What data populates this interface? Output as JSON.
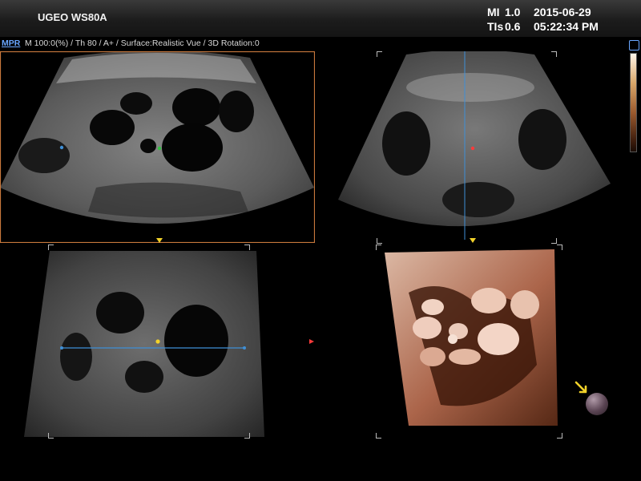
{
  "header": {
    "device_name": "UGEO WS80A",
    "mi_label": "MI",
    "mi_value": "1.0",
    "tis_label": "TIs",
    "tis_value": "0.6",
    "date": "2015-06-29",
    "time": "05:22:34 PM"
  },
  "infobar": {
    "mode_label": "MPR",
    "params": "M 100:0(%) / Th 80 / A+ / Surface:Realistic Vue / 3D Rotation:0"
  },
  "colors": {
    "frame_orange": "#c8783c",
    "axis_blue": "#3f8fd6",
    "marker_yellow": "#f2d22a",
    "marker_red": "#ff3b3b",
    "marker_green": "#2fc23f",
    "render_tone": "#d19a80"
  },
  "icons": {
    "colorbar_toggle": "colorbar-toggle-icon",
    "orientation_sphere": "orientation-sphere-icon",
    "arrow": "yellow-arrow-icon"
  }
}
